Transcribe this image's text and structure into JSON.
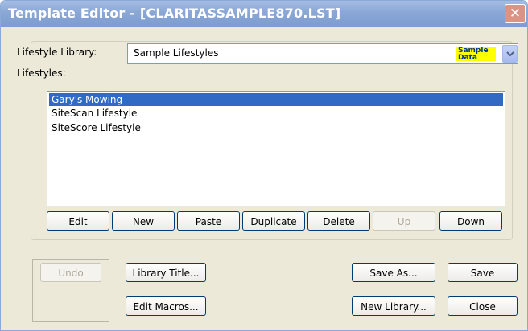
{
  "window": {
    "title": "Template Editor - [CLARITASSAMPLE870.LST]",
    "close_glyph": "✕"
  },
  "library": {
    "label": "Lifestyle Library:",
    "selected_value": "Sample Lifestyles",
    "badge_line1": "Sample",
    "badge_line2": "Data"
  },
  "lifestyles": {
    "label": "Lifestyles:",
    "items": [
      "Gary's Mowing",
      "SiteScan Lifestyle",
      "SiteScore Lifestyle"
    ],
    "selected_index": 0
  },
  "list_buttons": {
    "edit": "Edit",
    "new": "New",
    "paste": "Paste",
    "duplicate": "Duplicate",
    "delete": "Delete",
    "up": "Up",
    "down": "Down"
  },
  "bottom_buttons": {
    "undo": "Undo",
    "library_title": "Library Title...",
    "edit_macros": "Edit Macros...",
    "save_as": "Save As...",
    "new_library": "New Library...",
    "save": "Save",
    "close": "Close"
  },
  "colors": {
    "titlebar": "#8aa7d6",
    "selection": "#316ac5",
    "badge": "#ffff00",
    "dialog_bg": "#ece9d8"
  },
  "icons": {
    "close": "close-icon",
    "dropdown": "chevron-down-icon"
  }
}
